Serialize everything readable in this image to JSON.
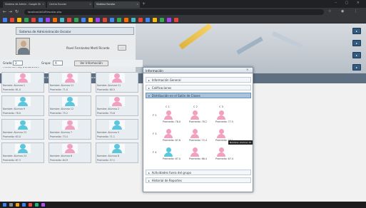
{
  "browser": {
    "tabs": [
      {
        "label": "Sistema de Admin - Google Sh",
        "active": false
      },
      {
        "label": "Centro Escolar",
        "active": false
      },
      {
        "label": "Sistema Escolar",
        "active": true
      }
    ],
    "url": "localhost/ASAP/escolar.php",
    "new_tab": "+"
  },
  "header": {
    "title": "Sistema de Administración Escolar",
    "user_name": "Pavel Fernández Martí Ricardo",
    "logout_label": "...",
    "date_text": "Fecha de hoy 26/12/2019"
  },
  "nav": {
    "items": [
      "» Tarea de los Alumnos",
      "» Tarea de los Docentes",
      "» Actividades Docentes",
      "» Información"
    ]
  },
  "filter": {
    "grado_label": "Grado:",
    "grado_value": "3",
    "grupo_label": "Grupo:",
    "grupo_value": "A",
    "ver_button": "Ver Información"
  },
  "cards": [
    {
      "r1": "Nombre:  Alumno 1",
      "r2": "Promedio:  61.0",
      "gender": "f"
    },
    {
      "r1": "Nombre:  Alumno 11",
      "r2": "Promedio:  71.0",
      "gender": "f"
    },
    {
      "r1": "Nombre:  Alumno 11",
      "r2": "Promedio:  60.5",
      "gender": "f"
    },
    {
      "r1": "Nombre:  Alumno 9",
      "r2": "Promedio:  78.0",
      "gender": "m"
    },
    {
      "r1": "Nombre:  Alumno 12",
      "r2": "Promedio:  75.2",
      "gender": "m"
    },
    {
      "r1": "Nombre:  Alumno 2",
      "r2": "Promedio:  75.6",
      "gender": "f"
    },
    {
      "r1": "Nombre:  Alumno 23",
      "r2": "Promedio:  63.0",
      "gender": "m"
    },
    {
      "r1": "Nombre:  Alumno 7",
      "r2": "Promedio:  73.4",
      "gender": "f"
    },
    {
      "r1": "Nombre:  Alumno 5",
      "r2": "Promedio:  71.1",
      "gender": "m"
    },
    {
      "r1": "Nombre:  Alumno 24",
      "r2": "Promedio:  67.3",
      "gender": "m"
    },
    {
      "r1": "Nombre:  Alumno 6",
      "r2": "Promedio:  64.9",
      "gender": "f"
    },
    {
      "r1": "Nombre:  Alumno 8",
      "r2": "Promedio:  57.1",
      "gender": "m"
    }
  ],
  "bottom_cards": [
    {
      "r1": "Nombre:  Alumno 10",
      "r2": "Promedio:  68.6"
    },
    {
      "r1": "Nombre:  Alumno 14",
      "r2": "Promedio:  64.6"
    }
  ],
  "dialog": {
    "title": "Información",
    "close": "×",
    "sections": [
      {
        "label": "Información General",
        "active": false
      },
      {
        "label": "Calificaciones",
        "active": false
      },
      {
        "label": "Distribución en el Salón de Clases",
        "active": true
      },
      {
        "label": "Actividades fuera del grupo",
        "active": false
      },
      {
        "label": "Historial de Reportes",
        "active": false
      }
    ],
    "columns": [
      "C 1",
      "C 2",
      "C 3"
    ],
    "rows": [
      {
        "label": "F 2",
        "seats": [
          {
            "gender": "f",
            "avg": "Promedio: 76.0"
          },
          {
            "gender": "f",
            "avg": "Promedio: 78.2"
          },
          {
            "gender": "f",
            "avg": "Promedio: 77.5"
          }
        ]
      },
      {
        "label": "F 3",
        "seats": [
          {
            "gender": "f",
            "avg": "Promedio: 67.6"
          },
          {
            "gender": "f",
            "avg": "Promedio: 72.4"
          },
          {
            "gender": "f",
            "avg": "Promedio: 73.1"
          }
        ]
      },
      {
        "label": "F 4",
        "seats": [
          {
            "gender": "m",
            "avg": "Promedio: 67.0"
          },
          {
            "gender": "f",
            "avg": "Promedio: 66.4"
          },
          {
            "gender": "f",
            "avg": "Promedio: 67.4"
          }
        ]
      }
    ],
    "tooltip": "Nombre: Alumno 15"
  },
  "colors": {
    "female": "#f2a0c0",
    "male": "#5cc6dc",
    "accordion_active": "#a7c4dc",
    "nav_band": "#5d6f80"
  }
}
